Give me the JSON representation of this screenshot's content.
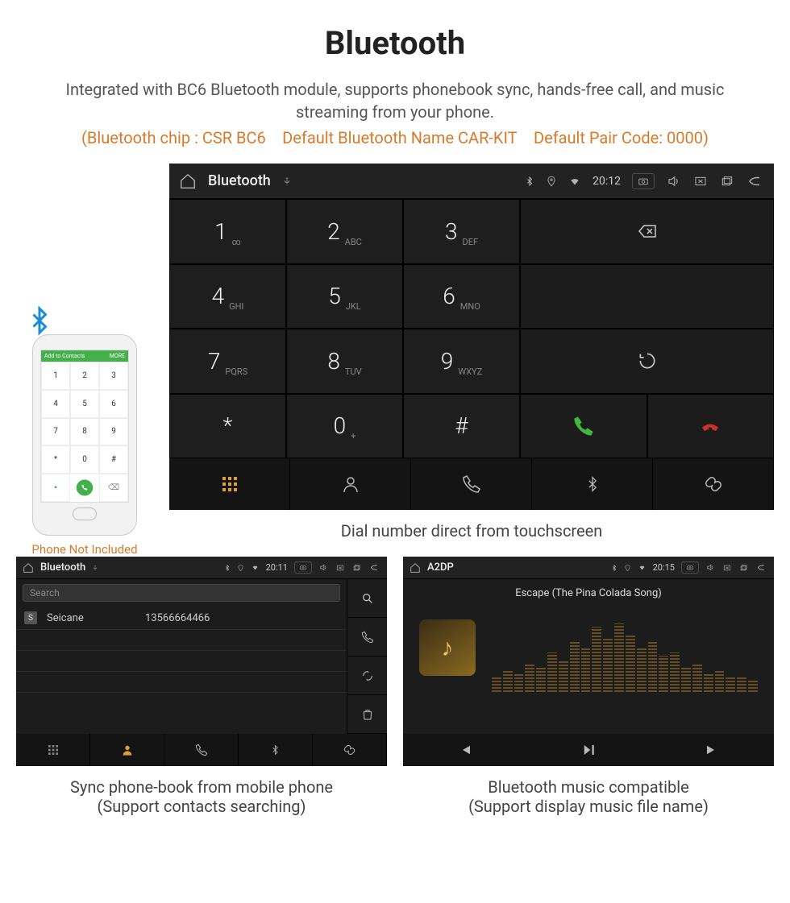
{
  "title": "Bluetooth",
  "subtitle": "Integrated with BC6 Bluetooth module, supports phonebook sync, hands-free call, and music streaming from your phone.",
  "spec_line": "(Bluetooth chip : CSR BC6 Default Bluetooth Name CAR-KIT Default Pair Code: 0000)",
  "phone": {
    "header_label": "Add to Contacts",
    "header_right": "MORE",
    "keys": [
      "1",
      "2",
      "3",
      "4",
      "5",
      "6",
      "7",
      "8",
      "9",
      "*",
      "0",
      "#"
    ],
    "note": "Phone Not Included"
  },
  "dialer": {
    "status": {
      "title": "Bluetooth",
      "time": "20:12"
    },
    "keys": [
      {
        "d": "1",
        "l": "∞"
      },
      {
        "d": "2",
        "l": "ABC"
      },
      {
        "d": "3",
        "l": "DEF"
      },
      {
        "d": "4",
        "l": "GHI"
      },
      {
        "d": "5",
        "l": "JKL"
      },
      {
        "d": "6",
        "l": "MNO"
      },
      {
        "d": "7",
        "l": "PQRS"
      },
      {
        "d": "8",
        "l": "TUV"
      },
      {
        "d": "9",
        "l": "WXYZ"
      },
      {
        "d": "*",
        "l": ""
      },
      {
        "d": "0",
        "l": "+"
      },
      {
        "d": "#",
        "l": ""
      }
    ],
    "caption": "Dial number direct from touchscreen"
  },
  "contacts": {
    "status": {
      "title": "Bluetooth",
      "time": "20:11"
    },
    "search_placeholder": "Search",
    "rows": [
      {
        "badge": "S",
        "name": "Seicane",
        "number": "13566664466"
      }
    ],
    "caption_line1": "Sync phone-book from mobile phone",
    "caption_line2": "(Support contacts searching)"
  },
  "music": {
    "status": {
      "title": "A2DP",
      "time": "20:15"
    },
    "track": "Escape (The Pina Colada Song)",
    "caption_line1": "Bluetooth music compatible",
    "caption_line2": "(Support display music file name)"
  }
}
